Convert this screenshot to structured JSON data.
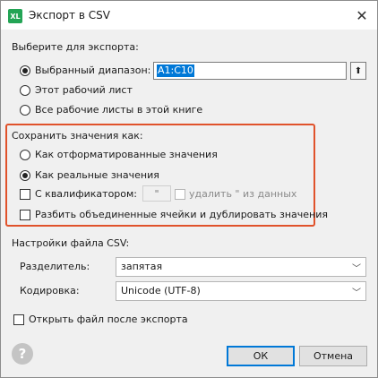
{
  "window": {
    "app_icon_text": "XL",
    "title": "Экспорт в CSV",
    "close_glyph": "✕"
  },
  "export_scope": {
    "heading": "Выберите для экспорта:",
    "options": [
      {
        "label": "Выбранный диапазон:",
        "selected": true
      },
      {
        "label": "Этот рабочий лист",
        "selected": false
      },
      {
        "label": "Все рабочие листы в этой книге",
        "selected": false
      }
    ],
    "range_value": "A1:C10",
    "range_picker_icon": "upload-arrow-icon"
  },
  "save_values": {
    "heading": "Сохранить значения как:",
    "options": [
      {
        "label": "Как отформатированные значения",
        "selected": false
      },
      {
        "label": "Как реальные значения",
        "selected": true
      }
    ],
    "qualifier": {
      "label": "С квалификатором:",
      "checked": false,
      "value": "\""
    },
    "remove_qualifier": {
      "label": "удалить \" из данных",
      "checked": false,
      "enabled": false
    },
    "split_merged": {
      "label": "Разбить объединенные ячейки и дублировать значения",
      "checked": false
    }
  },
  "csv_settings": {
    "heading": "Настройки файла CSV:",
    "delimiter": {
      "label": "Разделитель:",
      "value": "запятая"
    },
    "encoding": {
      "label": "Кодировка:",
      "value": "Unicode (UTF-8)"
    }
  },
  "open_after": {
    "label": "Открыть файл после экспорта",
    "checked": false
  },
  "footer": {
    "help_glyph": "?",
    "ok_label": "ОК",
    "cancel_label": "Отмена"
  },
  "colors": {
    "highlight_border": "#e0522b",
    "selection": "#0078d7",
    "app_icon": "#23a455"
  }
}
